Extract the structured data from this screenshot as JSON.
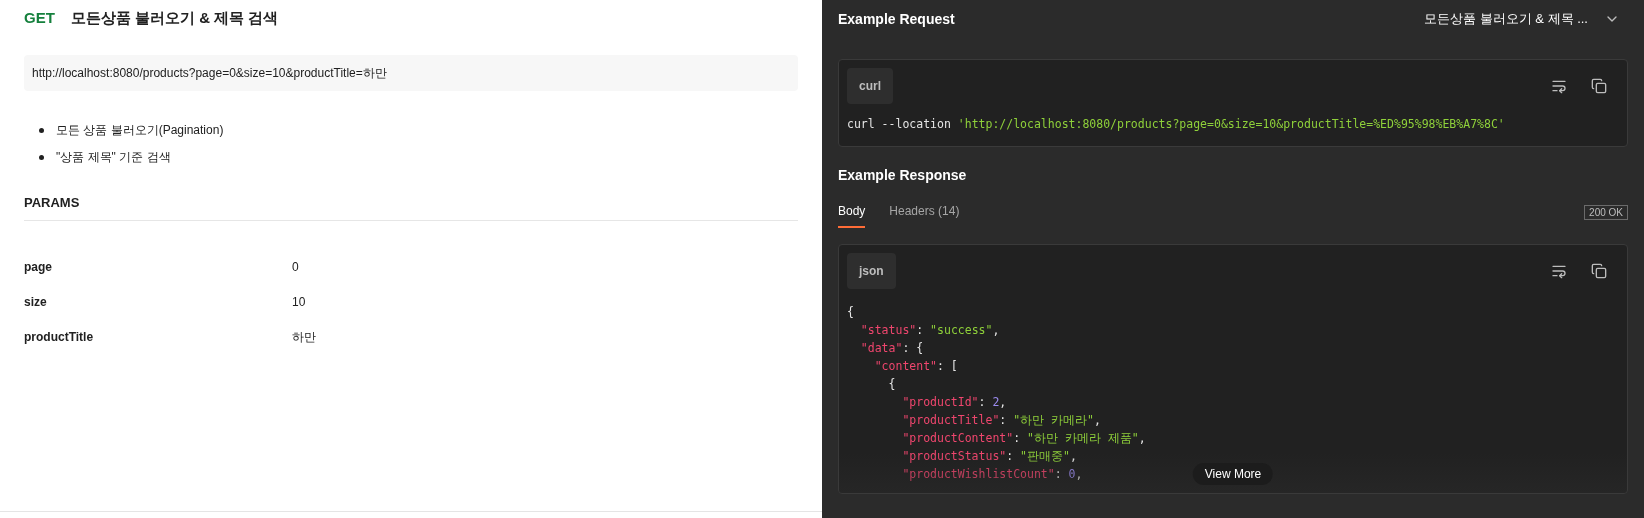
{
  "request": {
    "method": "GET",
    "title": "모든상품 불러오기 & 제목 검색",
    "url": "http://localhost:8080/products?page=0&size=10&productTitle=하만",
    "notes": [
      "모든 상품 불러오기(Pagination)",
      "\"상품 제목\" 기준 검색"
    ],
    "params_heading": "PARAMS",
    "params": [
      {
        "name": "page",
        "value": "0"
      },
      {
        "name": "size",
        "value": "10"
      },
      {
        "name": "productTitle",
        "value": "하만"
      }
    ]
  },
  "example_request": {
    "heading": "Example Request",
    "selector": "모든상품 불러오기 & 제목 ...",
    "language": "curl",
    "code": [
      {
        "kind": "plain",
        "text": "curl --location "
      },
      {
        "kind": "string",
        "text": "'http://localhost:8080/products?page=0&size=10&productTitle=%ED%95%98%EB%A7%8C'"
      }
    ]
  },
  "example_response": {
    "heading": "Example Response",
    "tabs": [
      {
        "label": "Body",
        "selected": true
      },
      {
        "label": "Headers (14)",
        "selected": false
      }
    ],
    "status": "200 OK",
    "language": "json",
    "lines": [
      [
        {
          "kind": "punct",
          "text": "{"
        }
      ],
      [
        {
          "kind": "key",
          "text": "  \"status\""
        },
        {
          "kind": "punct",
          "text": ": "
        },
        {
          "kind": "string",
          "text": "\"success\""
        },
        {
          "kind": "punct",
          "text": ","
        }
      ],
      [
        {
          "kind": "key",
          "text": "  \"data\""
        },
        {
          "kind": "punct",
          "text": ": {"
        }
      ],
      [
        {
          "kind": "key",
          "text": "    \"content\""
        },
        {
          "kind": "punct",
          "text": ": ["
        }
      ],
      [
        {
          "kind": "punct",
          "text": "      {"
        }
      ],
      [
        {
          "kind": "key",
          "text": "        \"productId\""
        },
        {
          "kind": "punct",
          "text": ": "
        },
        {
          "kind": "number",
          "text": "2"
        },
        {
          "kind": "punct",
          "text": ","
        }
      ],
      [
        {
          "kind": "key",
          "text": "        \"productTitle\""
        },
        {
          "kind": "punct",
          "text": ": "
        },
        {
          "kind": "string",
          "text": "\"하만 카메라\""
        },
        {
          "kind": "punct",
          "text": ","
        }
      ],
      [
        {
          "kind": "key",
          "text": "        \"productContent\""
        },
        {
          "kind": "punct",
          "text": ": "
        },
        {
          "kind": "string",
          "text": "\"하만 카메라 제품\""
        },
        {
          "kind": "punct",
          "text": ","
        }
      ],
      [
        {
          "kind": "key",
          "text": "        \"productStatus\""
        },
        {
          "kind": "punct",
          "text": ": "
        },
        {
          "kind": "string",
          "text": "\"판매중\""
        },
        {
          "kind": "punct",
          "text": ","
        }
      ],
      [
        {
          "kind": "key",
          "text": "        \"productWishlistCount\""
        },
        {
          "kind": "punct",
          "text": ": "
        },
        {
          "kind": "number",
          "text": "0"
        },
        {
          "kind": "punct",
          "text": ","
        }
      ]
    ],
    "view_more": "View More"
  }
}
